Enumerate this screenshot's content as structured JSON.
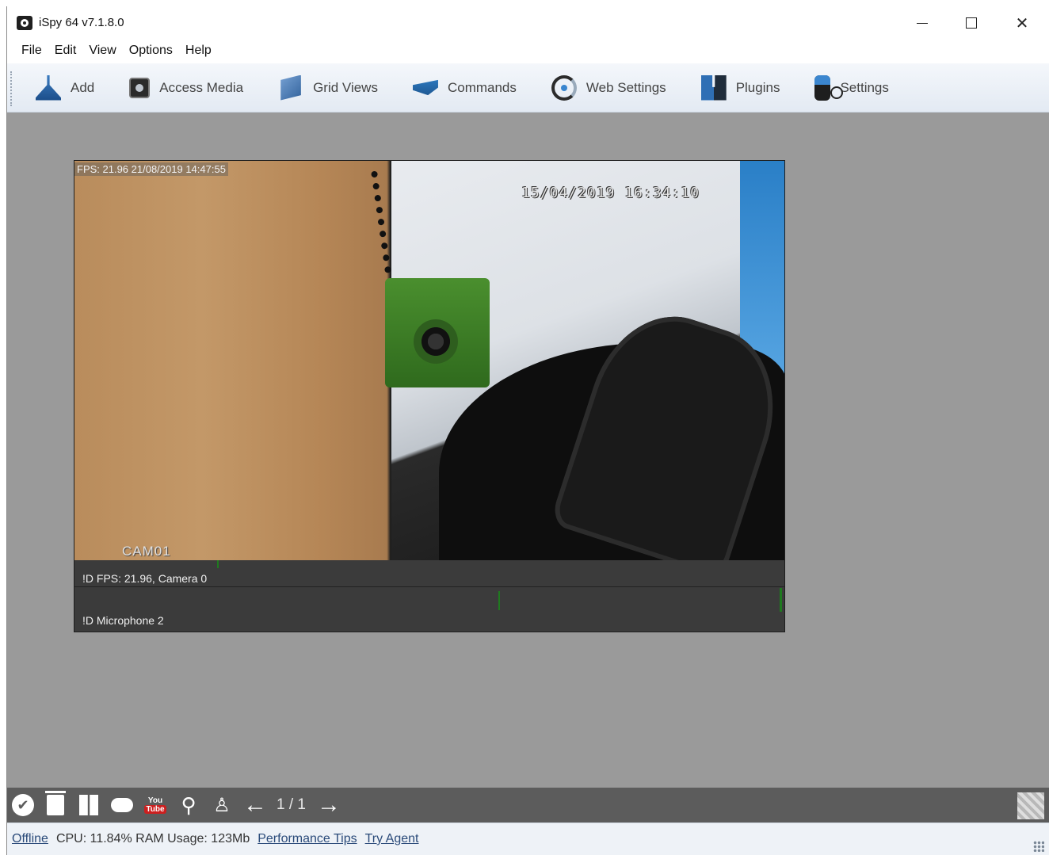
{
  "window": {
    "title": "iSpy 64 v7.1.8.0",
    "controls": {
      "minimize": "minimize",
      "maximize": "maximize",
      "close": "✕"
    }
  },
  "menu": {
    "items": [
      "File",
      "Edit",
      "View",
      "Options",
      "Help"
    ]
  },
  "toolbar": {
    "buttons": [
      {
        "label": "Add",
        "icon": "add-icon"
      },
      {
        "label": "Access Media",
        "icon": "media-icon"
      },
      {
        "label": "Grid Views",
        "icon": "grid-views-icon"
      },
      {
        "label": "Commands",
        "icon": "commands-icon"
      },
      {
        "label": "Web Settings",
        "icon": "web-settings-icon"
      },
      {
        "label": "Plugins",
        "icon": "plugins-icon"
      },
      {
        "label": "Settings",
        "icon": "settings-icon"
      }
    ]
  },
  "camera": {
    "fps_overlay": "FPS: 21.96 21/08/2019 14:47:55",
    "timestamp": "15/04/2019  16:34:10",
    "cam_name": "CAM01",
    "info_bar": "!D  FPS: 21.96, Camera 0"
  },
  "microphone": {
    "info_bar": "!D  Microphone 2"
  },
  "bottom_bar": {
    "page_indicator": "1 / 1",
    "youtube_top": "You",
    "youtube_bottom": "Tube",
    "check_glyph": "✔",
    "search_glyph": "⚲",
    "share_glyph": "♙",
    "prev_glyph": "←",
    "next_glyph": "→"
  },
  "status_bar": {
    "offline": "Offline",
    "stats": "CPU: 11.84% RAM Usage: 123Mb",
    "performance_tips": "Performance Tips",
    "try_agent": "Try Agent"
  }
}
